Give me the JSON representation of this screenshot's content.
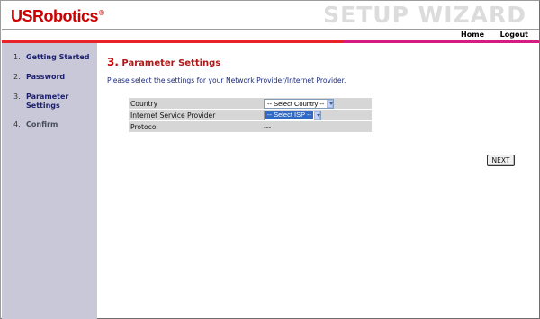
{
  "header": {
    "logo_text": "USRobotics",
    "logo_tm": "®",
    "wizard_title": "SETUP WIZARD"
  },
  "nav": {
    "home_label": "Home",
    "logout_label": "Logout"
  },
  "colors": {
    "brand_red": "#cc0000",
    "stripe_red": "#e8242a",
    "stripe_pink": "#d61c83",
    "sidebar_bg": "#c8c8d8",
    "link_blue": "#1b1f6e"
  },
  "sidebar": {
    "steps": [
      {
        "num": "1.",
        "label": "Getting Started"
      },
      {
        "num": "2.",
        "label": "Password"
      },
      {
        "num": "3.",
        "label": "Parameter Settings"
      },
      {
        "num": "4.",
        "label": "Confirm"
      }
    ],
    "current_step": 3
  },
  "main": {
    "title_num": "3.",
    "title_text": "Parameter Settings",
    "instruction": "Please select the settings for your Network Provider/Internet Provider.",
    "rows": [
      {
        "label": "Country",
        "value": "-- Select Country --"
      },
      {
        "label": "Internet Service Provider",
        "value": "-- Select ISP --"
      },
      {
        "label": "Protocol",
        "value": "---"
      }
    ],
    "next_label": "NEXT"
  }
}
